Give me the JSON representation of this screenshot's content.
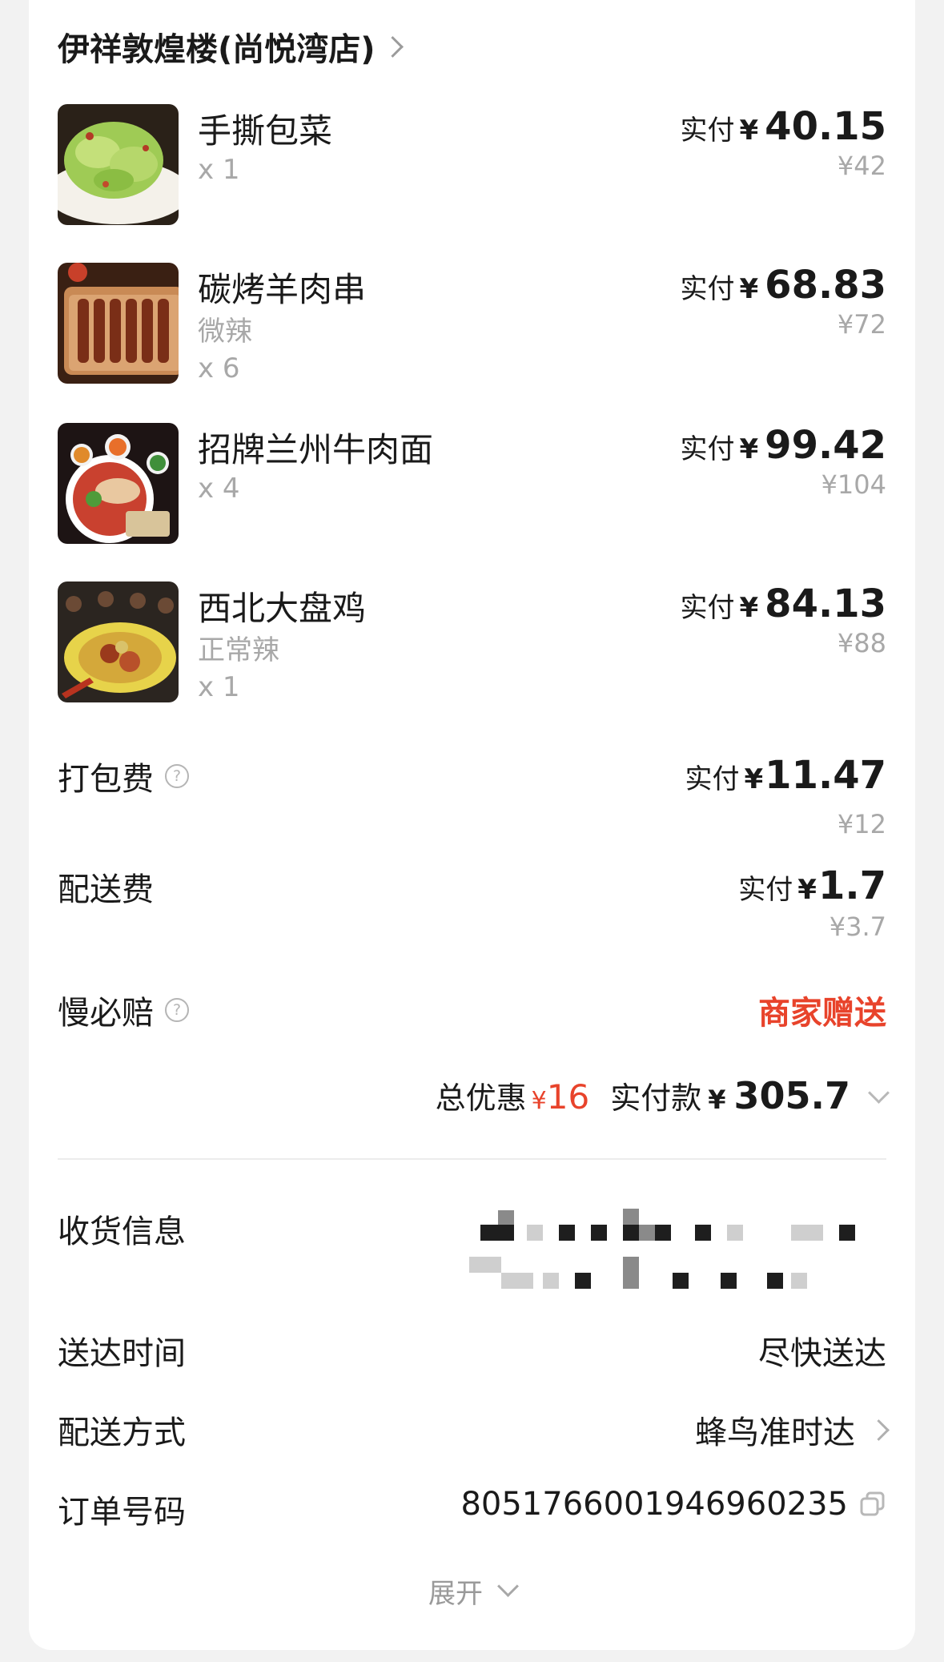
{
  "shop": {
    "name": "伊祥敦煌楼(尚悦湾店)"
  },
  "items": [
    {
      "name": "手撕包菜",
      "spec": "",
      "qty": "x 1",
      "pay_label": "实付",
      "currency": "¥",
      "paid": "40.15",
      "original": "¥42",
      "image": "cabbage-dish"
    },
    {
      "name": "碳烤羊肉串",
      "spec": "微辣",
      "qty": "x 6",
      "pay_label": "实付",
      "currency": "¥",
      "paid": "68.83",
      "original": "¥72",
      "image": "lamb-skewers"
    },
    {
      "name": "招牌兰州牛肉面",
      "spec": "",
      "qty": "x 4",
      "pay_label": "实付",
      "currency": "¥",
      "paid": "99.42",
      "original": "¥104",
      "image": "beef-noodles"
    },
    {
      "name": "西北大盘鸡",
      "spec": "正常辣",
      "qty": "x 1",
      "pay_label": "实付",
      "currency": "¥",
      "paid": "84.13",
      "original": "¥88",
      "image": "big-plate-chicken"
    }
  ],
  "fees": {
    "packing": {
      "label": "打包费",
      "pay_label": "实付",
      "currency": "¥",
      "paid": "11.47",
      "original": "¥12"
    },
    "delivery": {
      "label": "配送费",
      "pay_label": "实付",
      "currency": "¥",
      "paid": "1.7",
      "original": "¥3.7"
    },
    "late_guarantee": {
      "label": "慢必赔",
      "value": "商家赠送"
    }
  },
  "summary": {
    "discount_label": "总优惠",
    "discount_currency": "¥",
    "discount": "16",
    "paid_label": "实付款",
    "paid_currency": "¥",
    "paid": "305.7"
  },
  "info": {
    "address_label": "收货信息",
    "delivery_time_label": "送达时间",
    "delivery_time": "尽快送达",
    "delivery_method_label": "配送方式",
    "delivery_method": "蜂鸟准时达",
    "order_no_label": "订单号码",
    "order_no": "8051766001946960235"
  },
  "expand_label": "展开",
  "colors": {
    "accent_red": "#e8432b",
    "muted": "#a8a8a8",
    "text": "#1a1a1a",
    "background": "#f2f2f2"
  }
}
